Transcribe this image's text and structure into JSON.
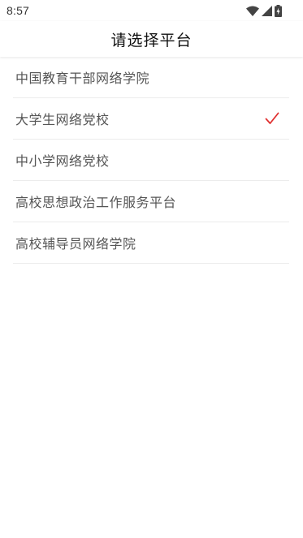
{
  "status_bar": {
    "time": "8:57",
    "icons": [
      "wifi-icon",
      "cellular-signal-icon",
      "battery-charging-icon"
    ]
  },
  "header": {
    "title": "请选择平台"
  },
  "platforms": [
    {
      "label": "中国教育干部网络学院",
      "selected": false
    },
    {
      "label": "大学生网络党校",
      "selected": true
    },
    {
      "label": "中小学网络党校",
      "selected": false
    },
    {
      "label": "高校思想政治工作服务平台",
      "selected": false
    },
    {
      "label": "高校辅导员网络学院",
      "selected": false
    }
  ],
  "colors": {
    "check_accent": "#e03030",
    "divider": "#ececec",
    "text_primary": "#111111",
    "text_secondary": "#555555"
  }
}
